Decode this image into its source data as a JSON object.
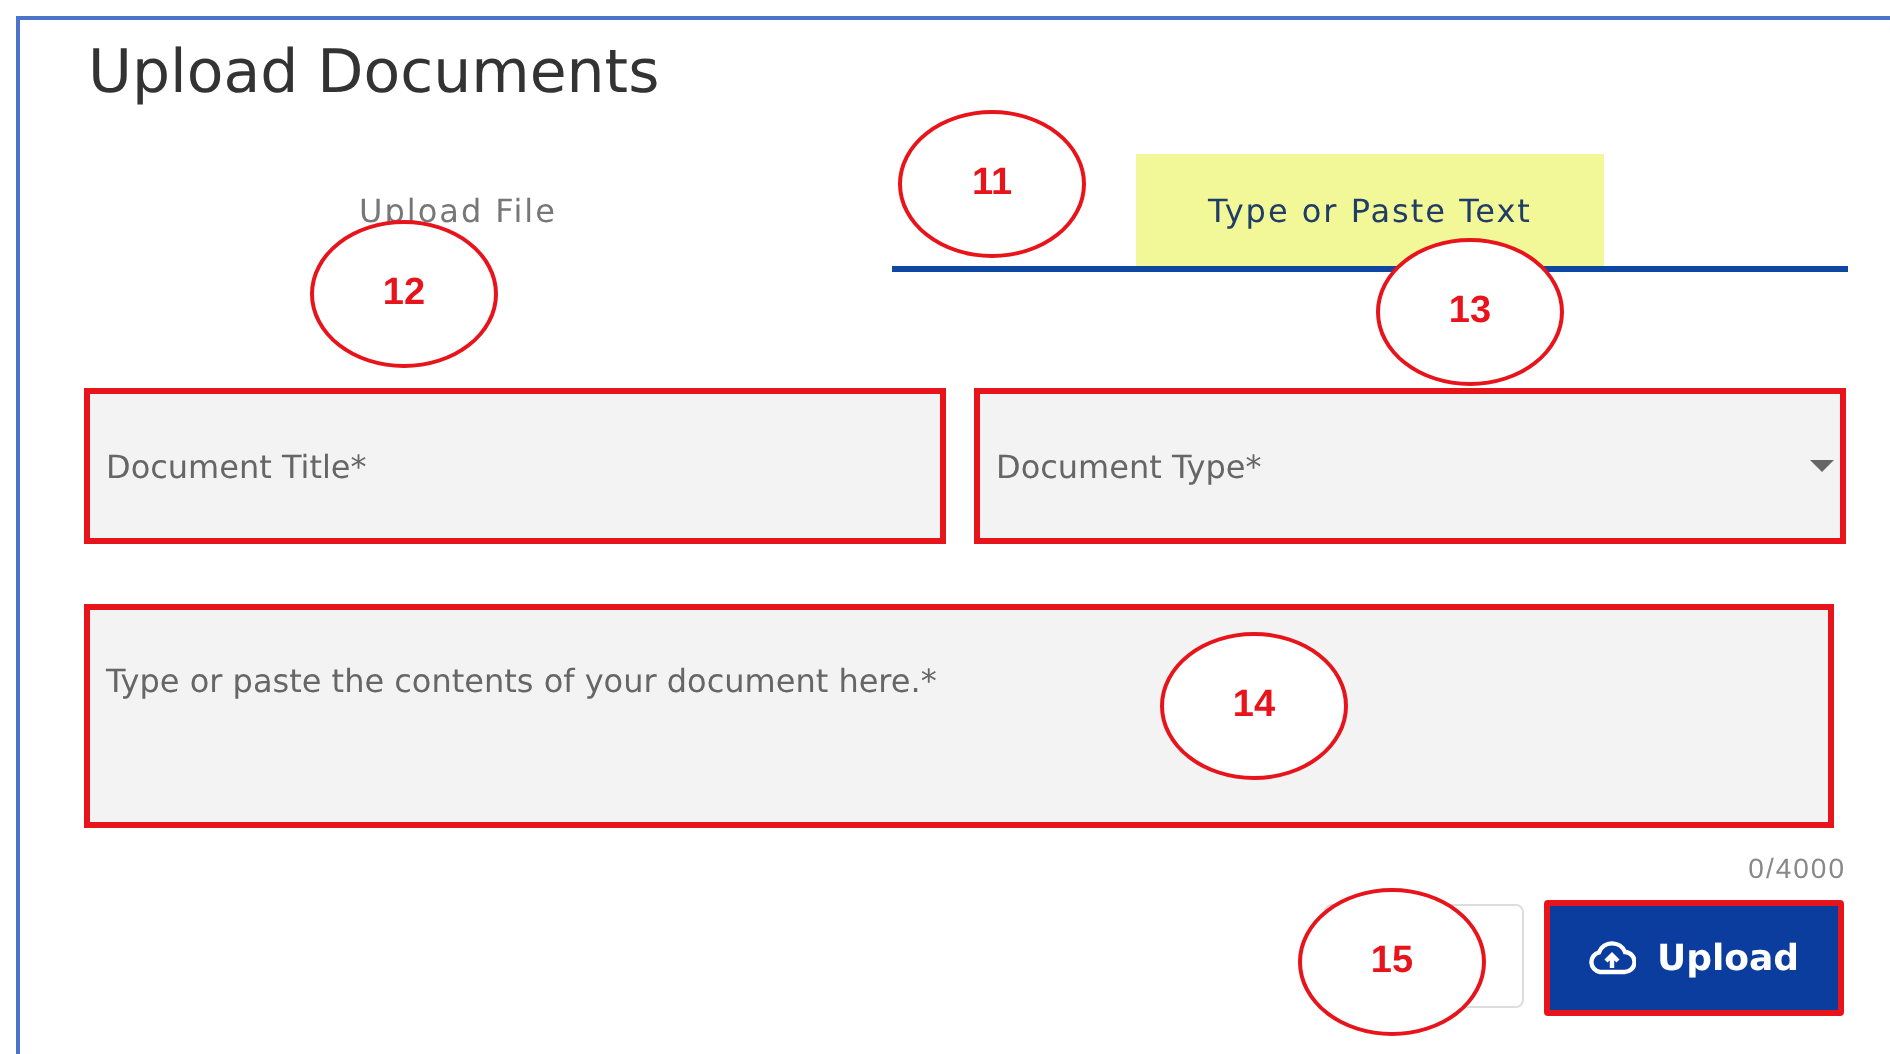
{
  "dialog": {
    "title": "Upload Documents"
  },
  "tabs": [
    {
      "label": "Upload File",
      "selected": false,
      "highlighted": false
    },
    {
      "label": "Type or Paste Text",
      "selected": true,
      "highlighted": true
    }
  ],
  "fields": [
    {
      "kind": "text",
      "placeholder": "Document Title*",
      "outlined": true
    },
    {
      "kind": "select",
      "placeholder": "Document Type*",
      "outlined": true
    },
    {
      "kind": "textarea",
      "placeholder": "Type or paste the contents of your document here.*",
      "outlined": true
    }
  ],
  "counter": "0/4000",
  "buttons": [
    {
      "kind": "secondary"
    },
    {
      "kind": "primary",
      "label": "Upload",
      "outlined": true
    }
  ],
  "callouts": [
    {
      "label": "11"
    },
    {
      "label": "12"
    },
    {
      "label": "13"
    },
    {
      "label": "14"
    },
    {
      "label": "15"
    }
  ]
}
